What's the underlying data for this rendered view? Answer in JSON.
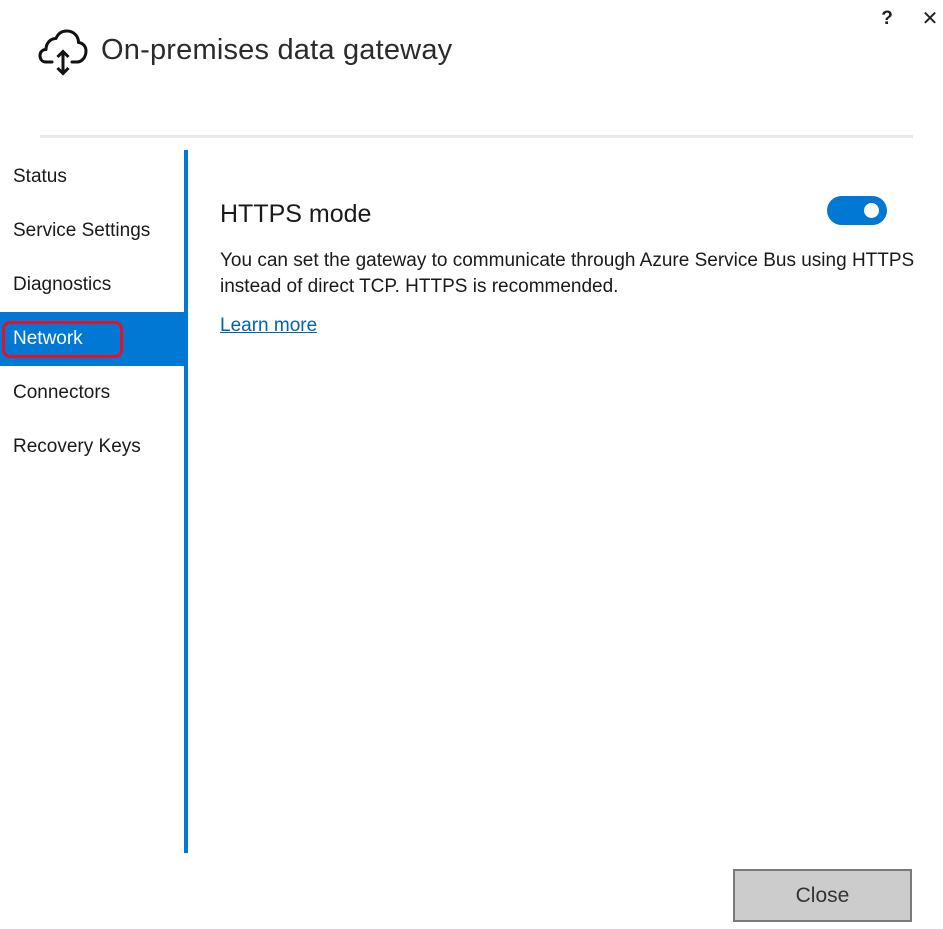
{
  "window": {
    "help_label": "?",
    "close_label": "✕"
  },
  "header": {
    "title": "On-premises data gateway",
    "icon": "cloud-upload-download-icon"
  },
  "sidebar": {
    "items": [
      {
        "label": "Status",
        "active": false
      },
      {
        "label": "Service Settings",
        "active": false
      },
      {
        "label": "Diagnostics",
        "active": false
      },
      {
        "label": "Network",
        "active": true
      },
      {
        "label": "Connectors",
        "active": false
      },
      {
        "label": "Recovery Keys",
        "active": false
      }
    ]
  },
  "main": {
    "section_title": "HTTPS mode",
    "https_toggle_on": true,
    "description": "You can set the gateway to communicate through Azure Service Bus using HTTPS instead of direct TCP. HTTPS is recommended.",
    "learn_more": "Learn more"
  },
  "footer": {
    "close_button": "Close"
  },
  "colors": {
    "accent": "#0078d4",
    "highlight": "#e81123",
    "link": "#0063b1",
    "button_bg": "#cccccc"
  }
}
